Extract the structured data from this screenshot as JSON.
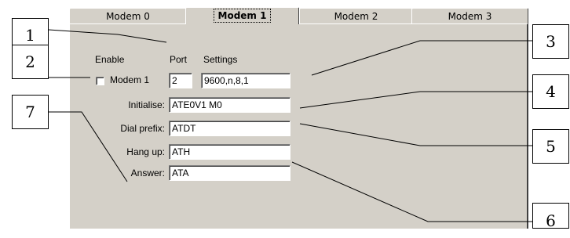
{
  "tabs": [
    "Modem 0",
    "Modem 1",
    "Modem 2",
    "Modem 3"
  ],
  "active_tab": "Modem 1",
  "headers": {
    "enable": "Enable",
    "port": "Port",
    "settings": "Settings"
  },
  "modem_checkbox_label": "Modem 1",
  "modem_enabled": false,
  "port_value": "2",
  "settings_value": "9600,n,8,1",
  "fields": {
    "initialise": {
      "label": "Initialise:",
      "value": "ATE0V1 M0"
    },
    "dial_prefix": {
      "label": "Dial prefix:",
      "value": "ATDT"
    },
    "hang_up": {
      "label": "Hang up:",
      "value": "ATH"
    },
    "answer": {
      "label": "Answer:",
      "value": "ATA"
    }
  },
  "callouts": [
    "1",
    "2",
    "3",
    "4",
    "5",
    "6",
    "7"
  ]
}
